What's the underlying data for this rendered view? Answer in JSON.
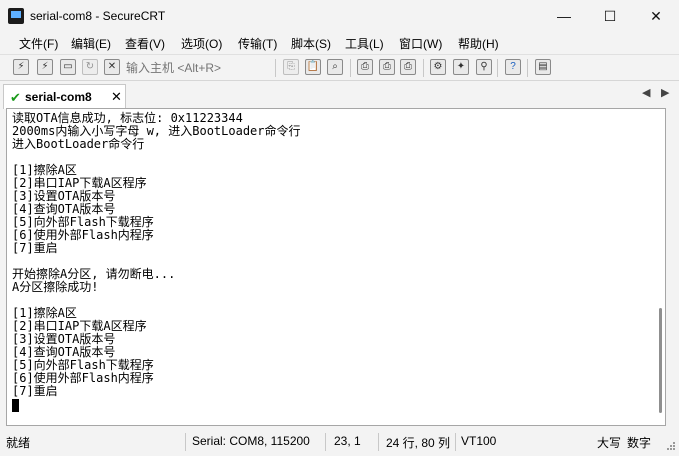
{
  "window": {
    "title": "serial-com8 - SecureCRT",
    "minimize": "—",
    "maximize": "☐",
    "close": "✕"
  },
  "menu": [
    "文件(F)",
    "编辑(E)",
    "查看(V)",
    "选项(O)",
    "传输(T)",
    "脚本(S)",
    "工具(L)",
    "窗口(W)",
    "帮助(H)"
  ],
  "toolbar": {
    "quick_input_placeholder": "输入主机 <Alt+R>",
    "icons": [
      "connect-icon",
      "quick-connect-icon",
      "connect-tab-icon",
      "reconnect-icon",
      "disconnect-icon",
      "copy-icon",
      "paste-icon",
      "find-icon",
      "print-setup-icon",
      "print-screen-icon",
      "print-icon",
      "session-options-icon",
      "global-options-icon",
      "keymap-icon",
      "help-icon",
      "sftp-icon"
    ]
  },
  "tabs": [
    {
      "label": "serial-com8",
      "close": "✕",
      "status_icon": "connected-check-icon"
    }
  ],
  "tab_nav": {
    "prev": "◀",
    "next": "▶"
  },
  "terminal": {
    "lines": [
      "读取OTA信息成功, 标志位: 0x11223344",
      "2000ms内输入小写字母 w, 进入BootLoader命令行",
      "进入BootLoader命令行",
      "",
      "[1]擦除A区",
      "[2]串口IAP下载A区程序",
      "[3]设置OTA版本号",
      "[4]查询OTA版本号",
      "[5]向外部Flash下载程序",
      "[6]使用外部Flash内程序",
      "[7]重启",
      "",
      "开始擦除A分区, 请勿断电...",
      "A分区擦除成功!",
      "",
      "[1]擦除A区",
      "[2]串口IAP下载A区程序",
      "[3]设置OTA版本号",
      "[4]查询OTA版本号",
      "[5]向外部Flash下载程序",
      "[6]使用外部Flash内程序",
      "[7]重启"
    ]
  },
  "status": {
    "ready": "就绪",
    "connection": "Serial: COM8, 115200",
    "position": "23,  1",
    "size": "24 行, 80 列",
    "terminal": "VT100",
    "caps": "大写",
    "num": "数字"
  }
}
